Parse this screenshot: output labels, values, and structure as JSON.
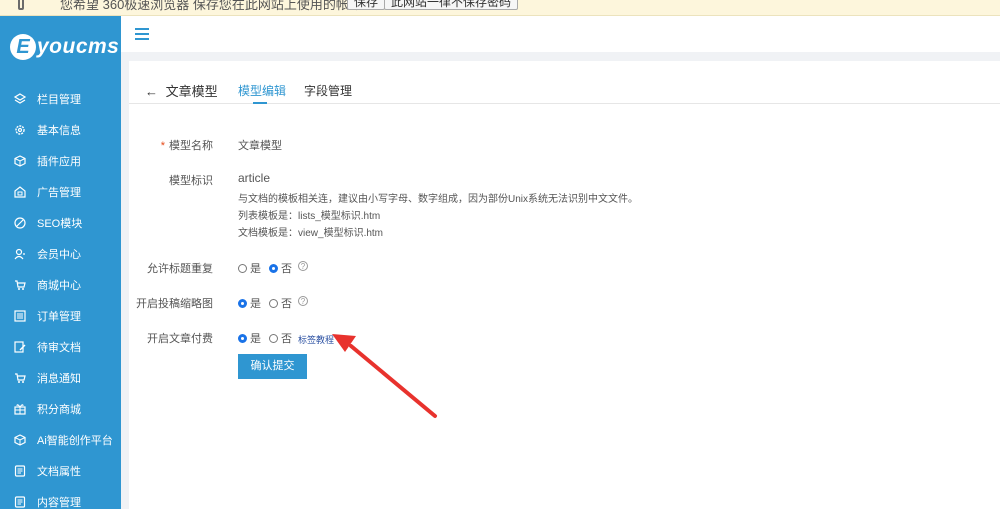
{
  "browser_bar": {
    "message": "您希望 360极速浏览器 保存您在此网站上使用的帐号吗?",
    "save_label": "保存",
    "never_label": "此网站一律不保存密码"
  },
  "brand": {
    "badge": "E",
    "name": "youcms",
    "color": "#2f96d1"
  },
  "sidebar": {
    "items": [
      {
        "icon": "layers-icon",
        "label": "栏目管理"
      },
      {
        "icon": "gear-icon",
        "label": "基本信息"
      },
      {
        "icon": "cube-icon",
        "label": "插件应用"
      },
      {
        "icon": "ad-icon",
        "label": "广告管理"
      },
      {
        "icon": "seo-icon",
        "label": "SEO模块"
      },
      {
        "icon": "user-icon",
        "label": "会员中心"
      },
      {
        "icon": "cart-icon",
        "label": "商城中心"
      },
      {
        "icon": "list-icon",
        "label": "订单管理"
      },
      {
        "icon": "edit-doc-icon",
        "label": "待审文档"
      },
      {
        "icon": "cart-icon",
        "label": "消息通知"
      },
      {
        "icon": "gift-icon",
        "label": "积分商城"
      },
      {
        "icon": "cube-icon",
        "label": "Ai智能创作平台"
      },
      {
        "icon": "doc-icon",
        "label": "文档属性"
      },
      {
        "icon": "doc-icon",
        "label": "内容管理"
      }
    ]
  },
  "page": {
    "back_label": "文章模型",
    "tabs": [
      {
        "label": "模型编辑",
        "active": true
      },
      {
        "label": "字段管理",
        "active": false
      }
    ]
  },
  "form": {
    "model_name": {
      "label": "模型名称",
      "required_mark": "*",
      "value": "文章模型"
    },
    "model_id": {
      "label": "模型标识",
      "value": "article",
      "hint1": "与文档的模板相关连，建议由小写字母、数字组成，因为部份Unix系统无法识别中文文件。",
      "hint2": "列表模板是：lists_模型标识.htm",
      "hint3": "文档模板是：view_模型标识.htm"
    },
    "allow_dup_title": {
      "label": "允许标题重复",
      "yes": "是",
      "no": "否",
      "selected": "no"
    },
    "thumb_upload": {
      "label": "开启投稿缩略图",
      "yes": "是",
      "no": "否",
      "selected": "yes"
    },
    "paid_article": {
      "label": "开启文章付费",
      "yes": "是",
      "no": "否",
      "selected": "yes",
      "tutorial": "标签教程"
    },
    "submit_label": "确认提交"
  },
  "colors": {
    "accent": "#2f96d1",
    "arrow": "#e8322d",
    "link": "#2d52a3"
  }
}
